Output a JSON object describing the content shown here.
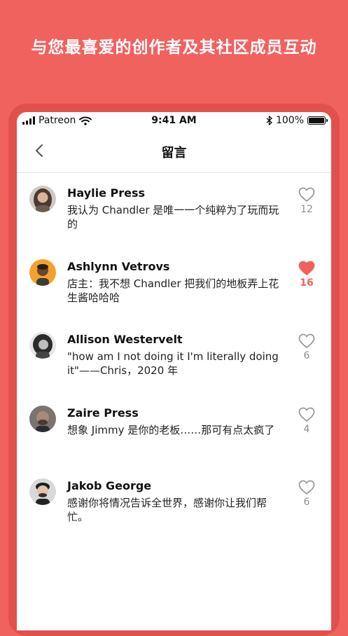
{
  "headline": "与您最喜爱的创作者及其社区成员互动",
  "status_bar": {
    "carrier": "Patreon",
    "time": "9:41 AM",
    "battery": "100%"
  },
  "nav": {
    "title": "留言"
  },
  "colors": {
    "brand": "#f0625e",
    "heart_outline": "#9a9a9a"
  },
  "comments": [
    {
      "name": "Haylie Press",
      "text": "我认为 Chandler 是唯一一个纯粹为了玩而玩的",
      "likes": "12",
      "liked": false
    },
    {
      "name": "Ashlynn Vetrovs",
      "text": "店主：我不想 Chandler 把我们的地板弄上花生酱哈哈哈",
      "likes": "16",
      "liked": true
    },
    {
      "name": "Allison Westervelt",
      "text": "\"how am I not doing it I'm literally doing it\"——Chris，2020 年",
      "likes": "6",
      "liked": false
    },
    {
      "name": "Zaire Press",
      "text": "想象 Jimmy 是你的老板……那可有点太疯了",
      "likes": "4",
      "liked": false
    },
    {
      "name": "Jakob George",
      "text": "感谢你将情况告诉全世界，感谢你让我们帮忙。",
      "likes": "6",
      "liked": false
    }
  ]
}
